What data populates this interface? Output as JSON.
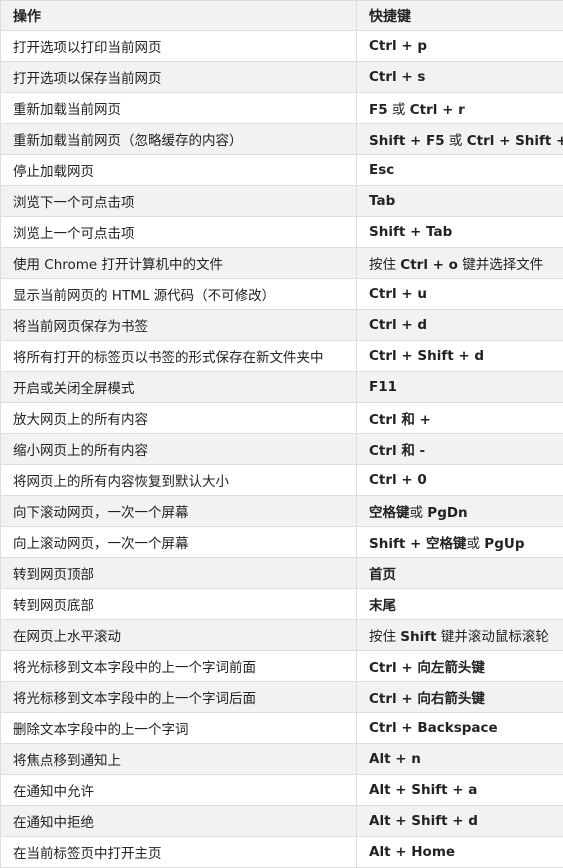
{
  "table": {
    "headers": [
      "操作",
      "快捷键"
    ],
    "rows": [
      {
        "action": "打开选项以打印当前网页",
        "shortcut": [
          {
            "t": "Ctrl + p",
            "b": true
          }
        ]
      },
      {
        "action": "打开选项以保存当前网页",
        "shortcut": [
          {
            "t": "Ctrl + s",
            "b": true
          }
        ]
      },
      {
        "action": "重新加载当前网页",
        "shortcut": [
          {
            "t": "F5",
            "b": true
          },
          {
            "t": " 或 ",
            "b": false
          },
          {
            "t": "Ctrl + r",
            "b": true
          }
        ]
      },
      {
        "action": "重新加载当前网页（忽略缓存的内容）",
        "shortcut": [
          {
            "t": "Shift + F5",
            "b": true
          },
          {
            "t": " 或 ",
            "b": false
          },
          {
            "t": "Ctrl + Shift + r",
            "b": true
          }
        ]
      },
      {
        "action": "停止加载网页",
        "shortcut": [
          {
            "t": "Esc",
            "b": true
          }
        ]
      },
      {
        "action": "浏览下一个可点击项",
        "shortcut": [
          {
            "t": "Tab",
            "b": true
          }
        ]
      },
      {
        "action": "浏览上一个可点击项",
        "shortcut": [
          {
            "t": "Shift + Tab",
            "b": true
          }
        ]
      },
      {
        "action": "使用 Chrome 打开计算机中的文件",
        "shortcut": [
          {
            "t": "按住 ",
            "b": false
          },
          {
            "t": "Ctrl + o",
            "b": true
          },
          {
            "t": " 键并选择文件",
            "b": false
          }
        ]
      },
      {
        "action": "显示当前网页的 HTML 源代码（不可修改）",
        "shortcut": [
          {
            "t": "Ctrl + u",
            "b": true
          }
        ]
      },
      {
        "action": "将当前网页保存为书签",
        "shortcut": [
          {
            "t": "Ctrl + d",
            "b": true
          }
        ]
      },
      {
        "action": "将所有打开的标签页以书签的形式保存在新文件夹中",
        "shortcut": [
          {
            "t": "Ctrl + Shift + d",
            "b": true
          }
        ]
      },
      {
        "action": "开启或关闭全屏模式",
        "shortcut": [
          {
            "t": "F11",
            "b": true
          }
        ]
      },
      {
        "action": "放大网页上的所有内容",
        "shortcut": [
          {
            "t": "Ctrl 和 +",
            "b": true
          }
        ]
      },
      {
        "action": "缩小网页上的所有内容",
        "shortcut": [
          {
            "t": "Ctrl 和 -",
            "b": true
          }
        ]
      },
      {
        "action": "将网页上的所有内容恢复到默认大小",
        "shortcut": [
          {
            "t": "Ctrl + 0",
            "b": true
          }
        ]
      },
      {
        "action": "向下滚动网页，一次一个屏幕",
        "shortcut": [
          {
            "t": "空格键",
            "b": true
          },
          {
            "t": "或 ",
            "b": false
          },
          {
            "t": "PgDn",
            "b": true
          }
        ]
      },
      {
        "action": "向上滚动网页，一次一个屏幕",
        "shortcut": [
          {
            "t": "Shift + 空格键",
            "b": true
          },
          {
            "t": "或 ",
            "b": false
          },
          {
            "t": "PgUp",
            "b": true
          }
        ]
      },
      {
        "action": "转到网页顶部",
        "shortcut": [
          {
            "t": "首页",
            "b": true
          }
        ]
      },
      {
        "action": "转到网页底部",
        "shortcut": [
          {
            "t": "末尾",
            "b": true
          }
        ]
      },
      {
        "action": "在网页上水平滚动",
        "shortcut": [
          {
            "t": "按住 ",
            "b": false
          },
          {
            "t": "Shift",
            "b": true
          },
          {
            "t": " 键并滚动鼠标滚轮",
            "b": false
          }
        ]
      },
      {
        "action": "将光标移到文本字段中的上一个字词前面",
        "shortcut": [
          {
            "t": "Ctrl + 向左箭头键",
            "b": true
          }
        ]
      },
      {
        "action": "将光标移到文本字段中的上一个字词后面",
        "shortcut": [
          {
            "t": "Ctrl + 向右箭头键",
            "b": true
          }
        ]
      },
      {
        "action": "删除文本字段中的上一个字词",
        "shortcut": [
          {
            "t": "Ctrl + Backspace",
            "b": true
          }
        ]
      },
      {
        "action": "将焦点移到通知上",
        "shortcut": [
          {
            "t": "Alt + n",
            "b": true
          }
        ]
      },
      {
        "action": "在通知中允许",
        "shortcut": [
          {
            "t": "Alt + Shift + a",
            "b": true
          }
        ]
      },
      {
        "action": "在通知中拒绝",
        "shortcut": [
          {
            "t": "Alt + Shift + d",
            "b": true
          }
        ]
      },
      {
        "action": "在当前标签页中打开主页",
        "shortcut": [
          {
            "t": "Alt + Home",
            "b": true
          }
        ]
      }
    ]
  }
}
